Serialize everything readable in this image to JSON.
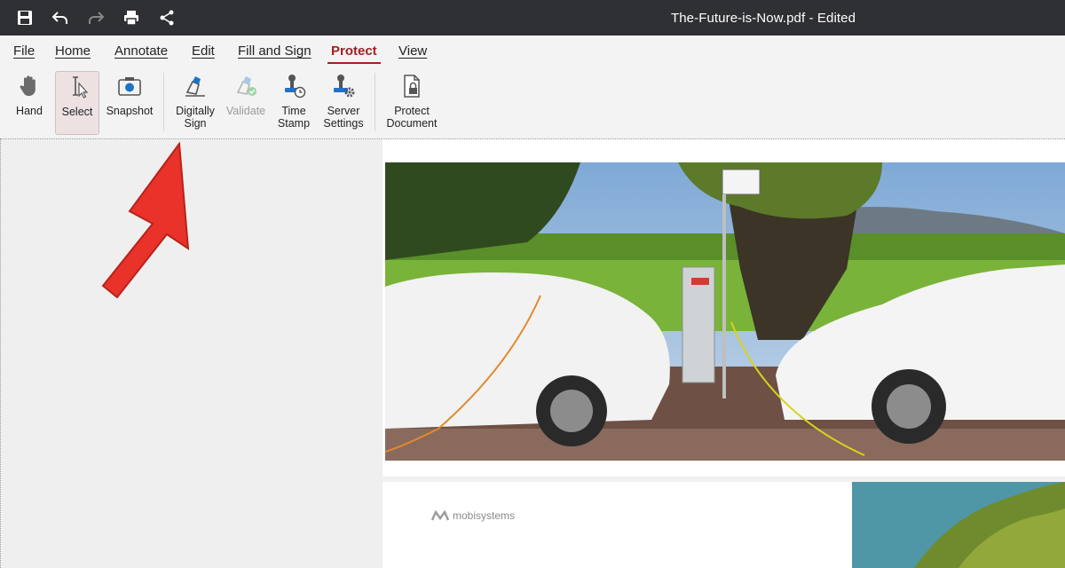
{
  "window": {
    "title": "The-Future-is-Now.pdf - Edited"
  },
  "quick_access": [
    {
      "name": "save-icon"
    },
    {
      "name": "undo-icon"
    },
    {
      "name": "redo-icon"
    },
    {
      "name": "print-icon"
    },
    {
      "name": "share-icon"
    }
  ],
  "menu": {
    "file": "File",
    "home": "Home",
    "annotate": "Annotate",
    "edit": "Edit",
    "fill_sign": "Fill and Sign",
    "protect": "Protect",
    "view": "View",
    "active": "Protect"
  },
  "ribbon": {
    "hand": "Hand",
    "select": "Select",
    "snapshot": "Snapshot",
    "digitally_sign_1": "Digitally",
    "digitally_sign_2": "Sign",
    "validate": "Validate",
    "time_stamp_1": "Time",
    "time_stamp_2": "Stamp",
    "server_settings_1": "Server",
    "server_settings_2": "Settings",
    "protect_document_1": "Protect",
    "protect_document_2": "Document"
  },
  "document": {
    "logo_text": "mobisystems"
  },
  "colors": {
    "accent": "#a31f24",
    "titlebar": "#2f3033",
    "arrow": "#e8322a"
  }
}
